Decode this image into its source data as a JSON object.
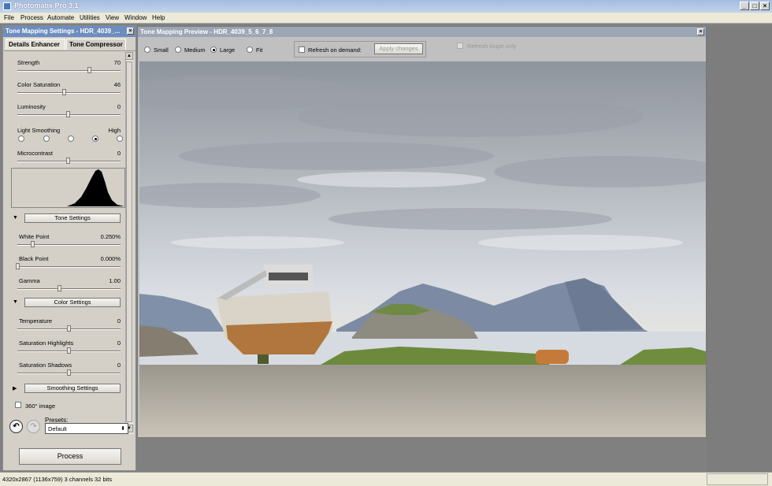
{
  "window": {
    "title": "Photomatix Pro 3.1",
    "min": "_",
    "max": "□",
    "close": "×"
  },
  "menu": [
    "File",
    "Process",
    "Automate",
    "Utilities",
    "View",
    "Window",
    "Help"
  ],
  "panel": {
    "title": "Tone Mapping Settings - HDR_4039_...",
    "tabs": [
      "Details Enhancer",
      "Tone Compressor"
    ],
    "sliders": [
      {
        "label": "Strength",
        "value": "70"
      },
      {
        "label": "Color Saturation",
        "value": "46"
      },
      {
        "label": "Luminosity",
        "value": "0"
      }
    ],
    "light_smoothing": {
      "label": "Light Smoothing",
      "value": "High",
      "selected_index": 3
    },
    "microcontrast": {
      "label": "Microcontrast",
      "value": "0"
    },
    "tone_settings": {
      "button": "Tone Settings",
      "white": {
        "label": "White Point",
        "value": "0.250%"
      },
      "black": {
        "label": "Black Point",
        "value": "0.000%"
      },
      "gamma": {
        "label": "Gamma",
        "value": "1.00"
      }
    },
    "color_settings": {
      "button": "Color Settings",
      "temp": {
        "label": "Temperature",
        "value": "0"
      },
      "sath": {
        "label": "Saturation Highlights",
        "value": "0"
      },
      "sats": {
        "label": "Saturation Shadows",
        "value": "0"
      }
    },
    "smoothing_settings": "Smoothing Settings",
    "image360": "360° image",
    "presets_label": "Presets:",
    "preset_value": "Default",
    "process": "Process"
  },
  "preview": {
    "title": "Tone Mapping Preview - HDR_4039_5_6_7_8",
    "sizes": [
      "Small",
      "Medium",
      "Large",
      "Fit"
    ],
    "selected_size": "Large",
    "refresh_on_demand": "Refresh on demand:",
    "apply_changes": "Apply changes",
    "refresh_loupe": "Refresh loupe only"
  },
  "status": "4320x2867 (1136x759) 3 channels 32 bits"
}
